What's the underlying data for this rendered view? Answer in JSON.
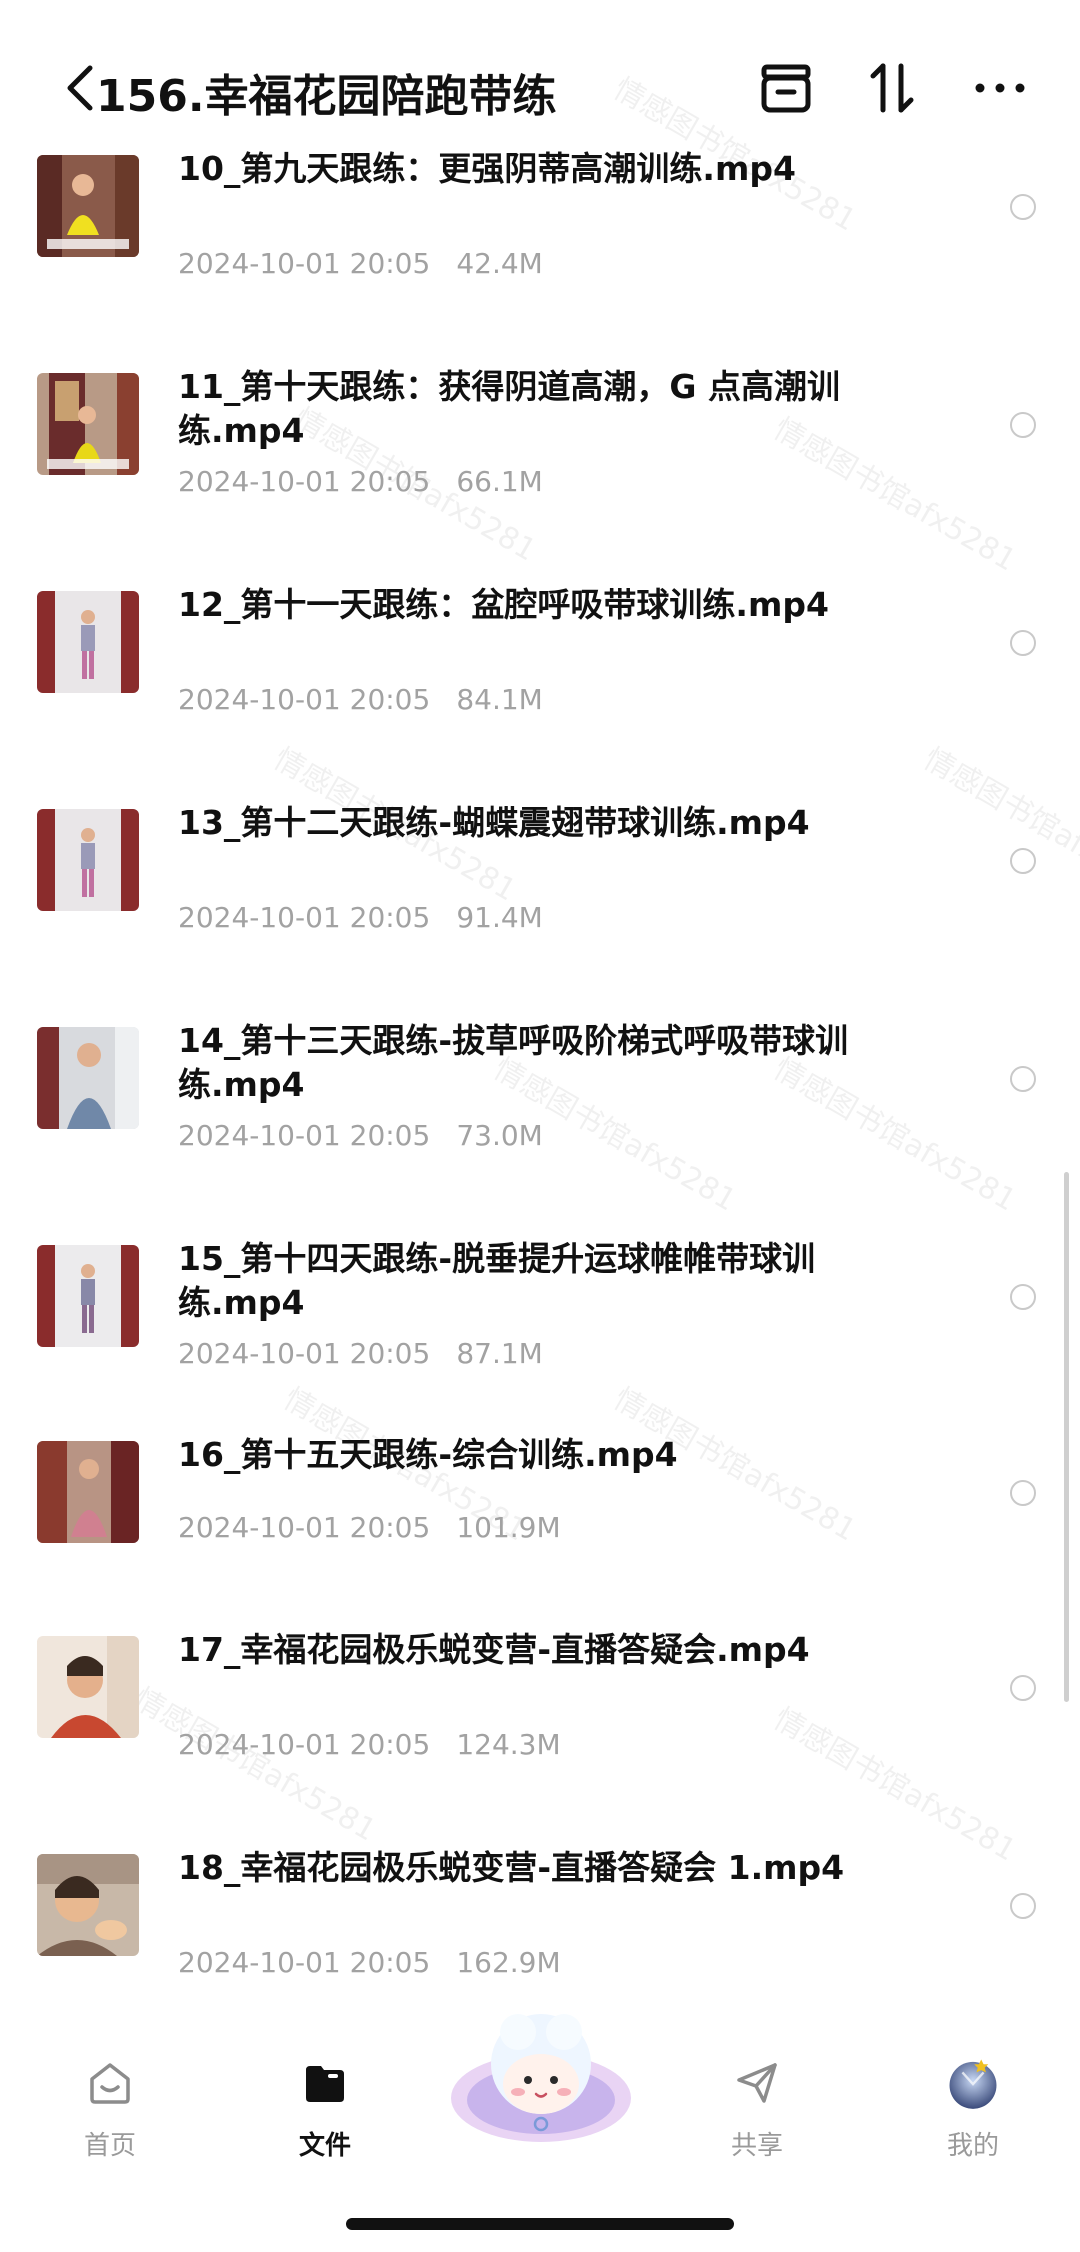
{
  "header": {
    "title": "156.幸福花园陪跑带练",
    "back_icon": "chevron-left-icon",
    "actions": [
      "archive-icon",
      "sort-icon",
      "more-icon"
    ]
  },
  "files": [
    {
      "name": "10_第九天跟练：更强阴蒂高潮训练.mp4",
      "date": "2024-10-01 20:05",
      "size": "42.4M"
    },
    {
      "name": "11_第十天跟练：获得阴道高潮，G 点高潮训练.mp4",
      "date": "2024-10-01 20:05",
      "size": "66.1M"
    },
    {
      "name": "12_第十一天跟练：盆腔呼吸带球训练.mp4",
      "date": "2024-10-01 20:05",
      "size": "84.1M"
    },
    {
      "name": "13_第十二天跟练-蝴蝶震翅带球训练.mp4",
      "date": "2024-10-01 20:05",
      "size": "91.4M"
    },
    {
      "name": "14_第十三天跟练-拔草呼吸阶梯式呼吸带球训练.mp4",
      "date": "2024-10-01 20:05",
      "size": "73.0M"
    },
    {
      "name": "15_第十四天跟练-脱垂提升运球帷帷带球训练.mp4",
      "date": "2024-10-01 20:05",
      "size": "87.1M"
    },
    {
      "name": "16_第十五天跟练-综合训练.mp4",
      "date": "2024-10-01 20:05",
      "size": "101.9M"
    },
    {
      "name": "17_幸福花园极乐蜕变营-直播答疑会.mp4",
      "date": "2024-10-01 20:05",
      "size": "124.3M"
    },
    {
      "name": "18_幸福花园极乐蜕变营-直播答疑会 1.mp4",
      "date": "2024-10-01 20:05",
      "size": "162.9M"
    }
  ],
  "watermark": "情感图书馆afx5281",
  "tabs": [
    {
      "label": "首页",
      "icon": "home-icon",
      "active": false
    },
    {
      "label": "文件",
      "icon": "folder-icon",
      "active": true
    },
    {
      "label": "共享",
      "icon": "send-icon",
      "active": false
    },
    {
      "label": "我的",
      "icon": "avatar",
      "active": false
    }
  ],
  "colors": {
    "accent": "#111111",
    "meta": "#a2a2a2",
    "radio": "#c9c9c9"
  }
}
